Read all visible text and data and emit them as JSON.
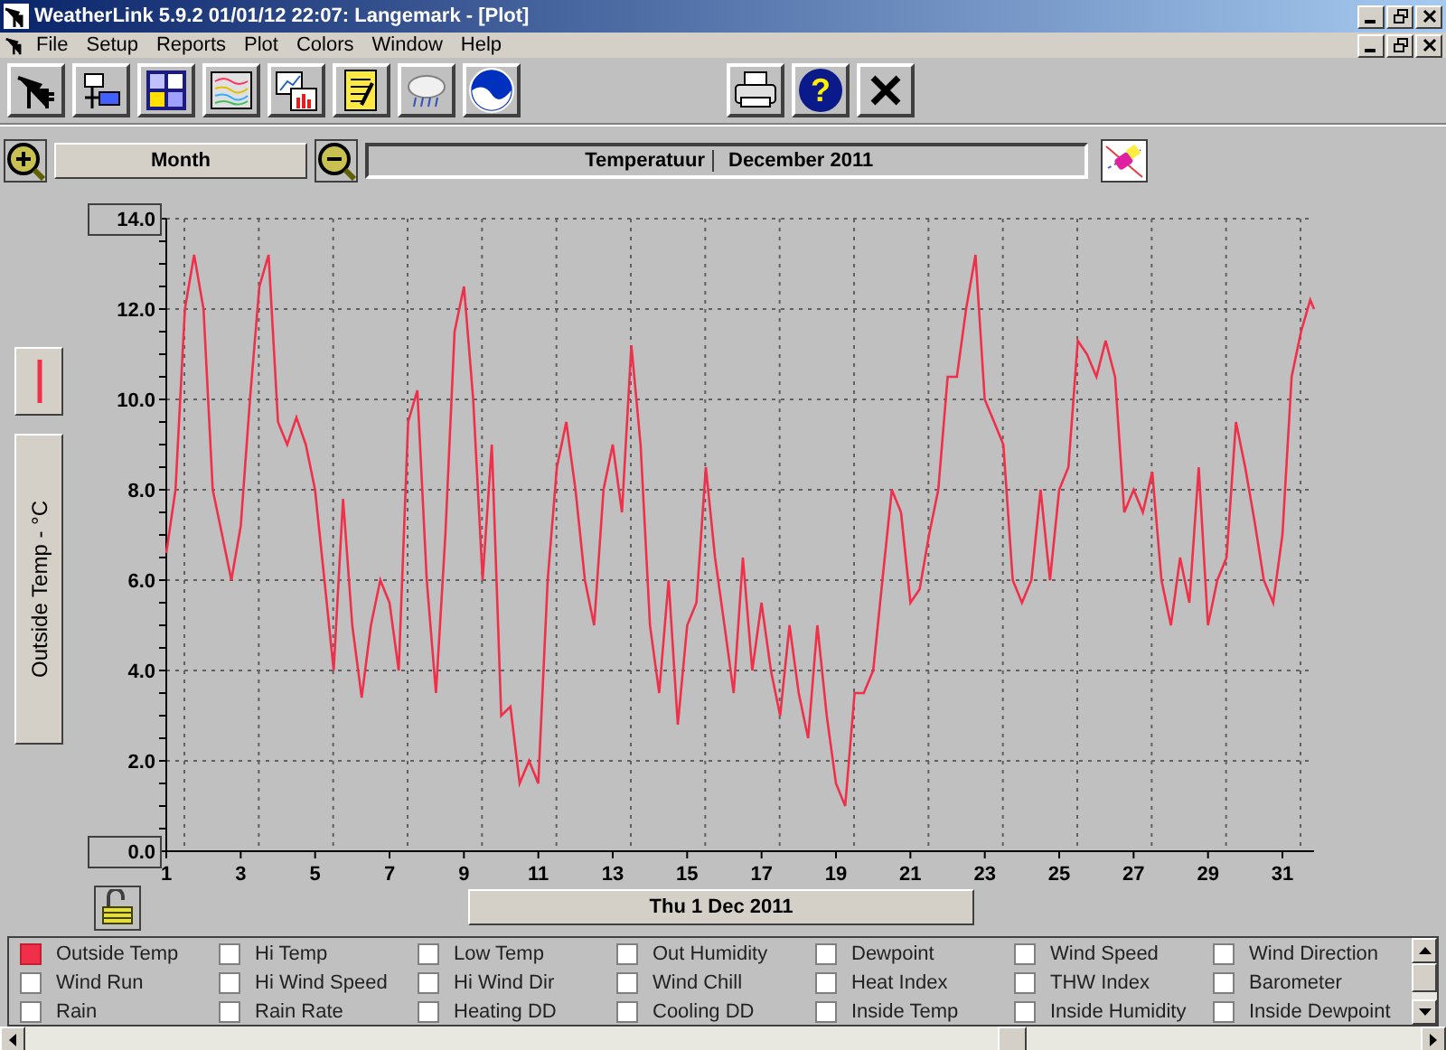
{
  "window": {
    "title": "WeatherLink 5.9.2  01/01/12  22:07: Langemark - [Plot]"
  },
  "menu": [
    {
      "label": "File"
    },
    {
      "label": "Setup"
    },
    {
      "label": "Reports"
    },
    {
      "label": "Plot"
    },
    {
      "label": "Colors"
    },
    {
      "label": "Window"
    },
    {
      "label": "Help"
    }
  ],
  "toolbar": {
    "help_label": "?"
  },
  "plot_header": {
    "period": "Month",
    "title": "Temperatuur",
    "subtitle": "December 2011"
  },
  "plot": {
    "y_axis_title": "Outside Temp - °C",
    "date": "Thu 1 Dec 2011",
    "chart_data": {
      "type": "line",
      "grid": true,
      "xlim": [
        1,
        31.85
      ],
      "ylim": [
        0,
        14
      ],
      "xticks": [
        1,
        3,
        5,
        7,
        9,
        11,
        13,
        15,
        17,
        19,
        21,
        23,
        25,
        27,
        29,
        31
      ],
      "yticks": [
        {
          "value": 0,
          "label": "0.0"
        },
        {
          "value": 2,
          "label": "2.0"
        },
        {
          "value": 4,
          "label": "4.0"
        },
        {
          "value": 6,
          "label": "6.0"
        },
        {
          "value": 8,
          "label": "8.0"
        },
        {
          "value": 10,
          "label": "10.0"
        },
        {
          "value": 12,
          "label": "12.0"
        },
        {
          "value": 14,
          "label": "14.0"
        }
      ],
      "x": [
        1,
        1.25,
        1.5,
        1.75,
        2,
        2.25,
        2.5,
        2.75,
        3,
        3.25,
        3.5,
        3.75,
        4,
        4.25,
        4.5,
        4.75,
        5,
        5.25,
        5.5,
        5.75,
        6,
        6.25,
        6.5,
        6.75,
        7,
        7.25,
        7.5,
        7.75,
        8,
        8.25,
        8.5,
        8.75,
        9,
        9.25,
        9.5,
        9.75,
        10,
        10.25,
        10.5,
        10.75,
        11,
        11.25,
        11.5,
        11.75,
        12,
        12.25,
        12.5,
        12.75,
        13,
        13.25,
        13.5,
        13.75,
        14,
        14.25,
        14.5,
        14.75,
        15,
        15.25,
        15.5,
        15.75,
        16,
        16.25,
        16.5,
        16.75,
        17,
        17.25,
        17.5,
        17.75,
        18,
        18.25,
        18.5,
        18.75,
        19,
        19.25,
        19.5,
        19.75,
        20,
        20.25,
        20.5,
        20.75,
        21,
        21.25,
        21.5,
        21.75,
        22,
        22.25,
        22.5,
        22.75,
        23,
        23.25,
        23.5,
        23.75,
        24,
        24.25,
        24.5,
        24.75,
        25,
        25.25,
        25.5,
        25.75,
        26,
        26.25,
        26.5,
        26.75,
        27,
        27.25,
        27.5,
        27.75,
        28,
        28.25,
        28.5,
        28.75,
        29,
        29.25,
        29.5,
        29.75,
        30,
        30.25,
        30.5,
        30.75,
        31,
        31.25,
        31.5,
        31.75,
        31.85
      ],
      "series": [
        {
          "color": "#f0304a",
          "values": [
            6.6,
            8,
            12,
            13.2,
            12,
            8,
            7,
            6,
            7.2,
            10,
            12.5,
            13.2,
            9.5,
            9,
            9.6,
            9,
            8,
            6,
            4,
            7.8,
            5,
            3.4,
            5,
            6,
            5.5,
            4,
            9.5,
            10.2,
            6,
            3.5,
            7,
            11.5,
            12.5,
            10,
            6,
            9,
            3,
            3.2,
            1.5,
            2,
            1.5,
            6,
            8.5,
            9.5,
            8,
            6,
            5,
            8,
            9,
            7.5,
            11.2,
            9,
            5,
            3.5,
            6,
            2.8,
            5,
            5.5,
            8.5,
            6.5,
            5,
            3.5,
            6.5,
            4,
            5.5,
            4,
            3,
            5,
            3.5,
            2.5,
            5,
            3,
            1.5,
            1,
            3.5,
            3.5,
            4,
            6,
            8,
            7.5,
            5.5,
            5.8,
            7,
            8,
            10.5,
            10.5,
            12,
            13.2,
            10,
            9.5,
            9,
            6,
            5.5,
            6,
            8,
            6,
            8,
            8.5,
            11.3,
            11,
            10.5,
            11.3,
            10.5,
            7.5,
            8,
            7.5,
            8.4,
            6,
            5,
            6.5,
            5.5,
            8.5,
            5,
            6,
            6.5,
            9.5,
            8.5,
            7.3,
            6,
            5.5,
            7,
            10.5,
            11.5,
            12.2,
            12
          ]
        }
      ]
    }
  },
  "series_checkboxes": [
    {
      "label": "Outside Temp",
      "checked": true
    },
    {
      "label": "Hi Temp",
      "checked": false
    },
    {
      "label": "Low Temp",
      "checked": false
    },
    {
      "label": "Out Humidity",
      "checked": false
    },
    {
      "label": "Dewpoint",
      "checked": false
    },
    {
      "label": "Wind Speed",
      "checked": false
    },
    {
      "label": "Wind Direction",
      "checked": false
    },
    {
      "label": "Wind Run",
      "checked": false
    },
    {
      "label": "Hi Wind Speed",
      "checked": false
    },
    {
      "label": "Hi Wind Dir",
      "checked": false
    },
    {
      "label": "Wind Chill",
      "checked": false
    },
    {
      "label": "Heat Index",
      "checked": false
    },
    {
      "label": "THW Index",
      "checked": false
    },
    {
      "label": "Barometer",
      "checked": false
    },
    {
      "label": "Rain",
      "checked": false
    },
    {
      "label": "Rain Rate",
      "checked": false
    },
    {
      "label": "Heating DD",
      "checked": false
    },
    {
      "label": "Cooling DD",
      "checked": false
    },
    {
      "label": "Inside Temp",
      "checked": false
    },
    {
      "label": "Inside Humidity",
      "checked": false
    },
    {
      "label": "Inside Dewpoint",
      "checked": false
    }
  ]
}
